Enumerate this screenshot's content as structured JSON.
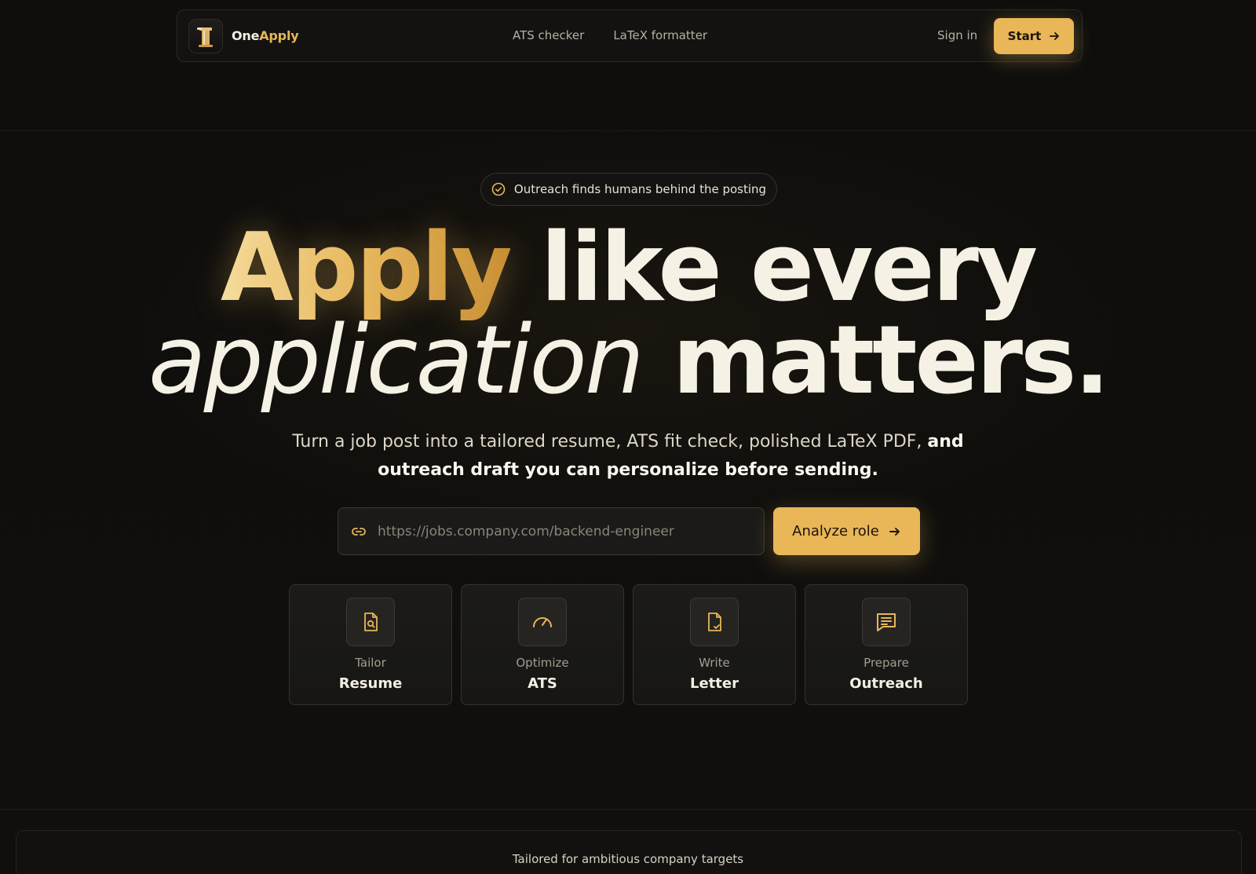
{
  "nav": {
    "brand_one": "One",
    "brand_apply": "Apply",
    "links": [
      "ATS checker",
      "LaTeX formatter"
    ],
    "signin": "Sign in",
    "start": "Start"
  },
  "badge": {
    "text": "Outreach finds humans behind the posting"
  },
  "hero": {
    "gold_word": "Apply",
    "line1_rest": "like every",
    "italic_word": "application",
    "line2_rest": "matters."
  },
  "subtitle": {
    "part1": "Turn a job post into a tailored resume, ATS fit check, polished LaTeX PDF,",
    "part2": "and outreach draft you can personalize before sending."
  },
  "search": {
    "placeholder": "https://jobs.company.com/backend-engineer",
    "value": ""
  },
  "analyze_button": "Analyze role",
  "cards": [
    {
      "small": "Tailor",
      "big": "Resume",
      "icon": "resume-search-icon"
    },
    {
      "small": "Optimize",
      "big": "ATS",
      "icon": "gauge-icon"
    },
    {
      "small": "Write",
      "big": "Letter",
      "icon": "document-check-icon"
    },
    {
      "small": "Prepare",
      "big": "Outreach",
      "icon": "message-icon"
    }
  ],
  "bottom": {
    "text": "Tailored for ambitious company targets"
  },
  "colors": {
    "accent": "#e9b658",
    "background": "#0f0e0c",
    "text": "#f6f1e5"
  }
}
